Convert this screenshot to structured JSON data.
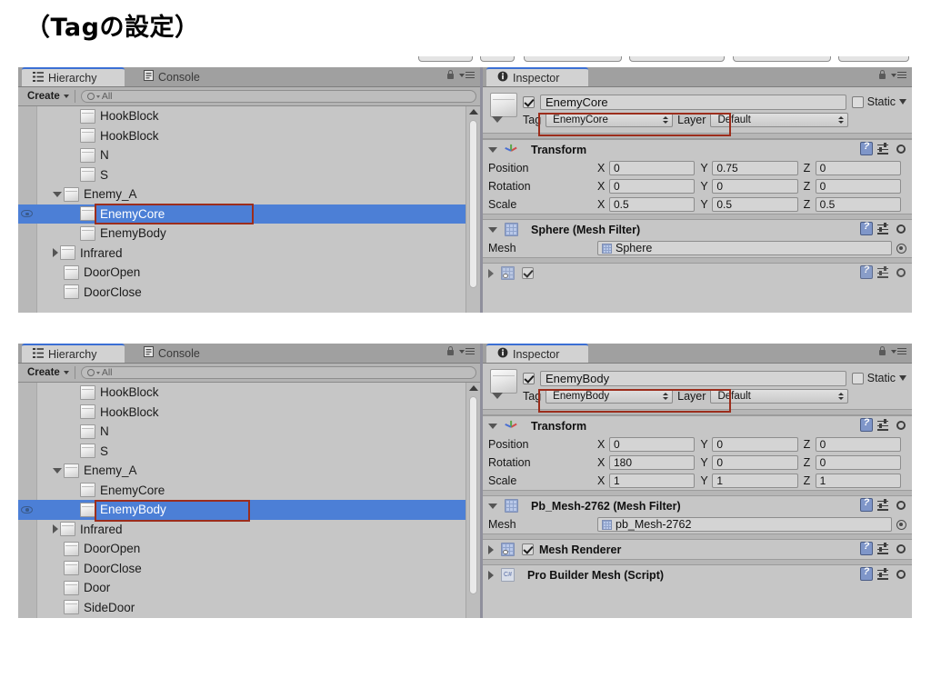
{
  "slide": {
    "title": "（Tagの設定）"
  },
  "shots": [
    {
      "hierarchy": {
        "tabs": [
          {
            "label": "Hierarchy",
            "icon": "hierarchy-list-icon",
            "active": true
          },
          {
            "label": "Console",
            "icon": "console-icon",
            "active": false
          }
        ],
        "toolbar": {
          "create_label": "Create",
          "search_placeholder": "All"
        },
        "tools": {
          "lock": "lock-icon",
          "menu": "panel-menu-icon"
        },
        "items": [
          {
            "label": "HookBlock",
            "depth": 2,
            "disclosure": "none",
            "selected": false,
            "visible_eye": false
          },
          {
            "label": "HookBlock",
            "depth": 2,
            "disclosure": "none",
            "selected": false,
            "visible_eye": false
          },
          {
            "label": "N",
            "depth": 2,
            "disclosure": "none",
            "selected": false,
            "visible_eye": false
          },
          {
            "label": "S",
            "depth": 2,
            "disclosure": "none",
            "selected": false,
            "visible_eye": false
          },
          {
            "label": "Enemy_A",
            "depth": 1,
            "disclosure": "open",
            "selected": false,
            "visible_eye": false
          },
          {
            "label": "EnemyCore",
            "depth": 2,
            "disclosure": "none",
            "selected": true,
            "visible_eye": true
          },
          {
            "label": "EnemyBody",
            "depth": 2,
            "disclosure": "none",
            "selected": false,
            "visible_eye": false
          },
          {
            "label": "Infrared",
            "depth": 1,
            "disclosure": "closed",
            "selected": false,
            "visible_eye": false
          },
          {
            "label": "DoorOpen",
            "depth": 1,
            "disclosure": "none",
            "selected": false,
            "visible_eye": false
          },
          {
            "label": "DoorClose",
            "depth": 1,
            "disclosure": "none",
            "selected": false,
            "visible_eye": false
          }
        ]
      },
      "inspector": {
        "tab": {
          "label": "Inspector",
          "icon": "info-icon"
        },
        "tools": {
          "lock": "lock-icon",
          "menu": "panel-menu-icon"
        },
        "object": {
          "enabled": true,
          "name": "EnemyCore",
          "static_label": "Static",
          "static_checked": false,
          "tag_label": "Tag",
          "tag_value": "EnemyCore",
          "layer_label": "Layer",
          "layer_value": "Default"
        },
        "transform": {
          "title": "Transform",
          "rows": [
            {
              "label": "Position",
              "x": "0",
              "y": "0.75",
              "z": "0"
            },
            {
              "label": "Rotation",
              "x": "0",
              "y": "0",
              "z": "0"
            },
            {
              "label": "Scale",
              "x": "0.5",
              "y": "0.5",
              "z": "0.5"
            }
          ],
          "axes": [
            "X",
            "Y",
            "Z"
          ]
        },
        "meshfilter": {
          "title": "Sphere (Mesh Filter)",
          "mesh_label": "Mesh",
          "mesh_value": "Sphere"
        }
      }
    },
    {
      "hierarchy": {
        "tabs": [
          {
            "label": "Hierarchy",
            "icon": "hierarchy-list-icon",
            "active": true
          },
          {
            "label": "Console",
            "icon": "console-icon",
            "active": false
          }
        ],
        "toolbar": {
          "create_label": "Create",
          "search_placeholder": "All"
        },
        "tools": {
          "lock": "lock-icon",
          "menu": "panel-menu-icon"
        },
        "items": [
          {
            "label": "HookBlock",
            "depth": 2,
            "disclosure": "none",
            "selected": false,
            "visible_eye": false
          },
          {
            "label": "HookBlock",
            "depth": 2,
            "disclosure": "none",
            "selected": false,
            "visible_eye": false
          },
          {
            "label": "N",
            "depth": 2,
            "disclosure": "none",
            "selected": false,
            "visible_eye": false
          },
          {
            "label": "S",
            "depth": 2,
            "disclosure": "none",
            "selected": false,
            "visible_eye": false
          },
          {
            "label": "Enemy_A",
            "depth": 1,
            "disclosure": "open",
            "selected": false,
            "visible_eye": false
          },
          {
            "label": "EnemyCore",
            "depth": 2,
            "disclosure": "none",
            "selected": false,
            "visible_eye": false
          },
          {
            "label": "EnemyBody",
            "depth": 2,
            "disclosure": "none",
            "selected": true,
            "visible_eye": true
          },
          {
            "label": "Infrared",
            "depth": 1,
            "disclosure": "closed",
            "selected": false,
            "visible_eye": false
          },
          {
            "label": "DoorOpen",
            "depth": 1,
            "disclosure": "none",
            "selected": false,
            "visible_eye": false
          },
          {
            "label": "DoorClose",
            "depth": 1,
            "disclosure": "none",
            "selected": false,
            "visible_eye": false
          },
          {
            "label": "Door",
            "depth": 1,
            "disclosure": "none",
            "selected": false,
            "visible_eye": false
          },
          {
            "label": "SideDoor",
            "depth": 1,
            "disclosure": "none",
            "selected": false,
            "visible_eye": false
          }
        ]
      },
      "inspector": {
        "tab": {
          "label": "Inspector",
          "icon": "info-icon"
        },
        "tools": {
          "lock": "lock-icon",
          "menu": "panel-menu-icon"
        },
        "object": {
          "enabled": true,
          "name": "EnemyBody",
          "static_label": "Static",
          "static_checked": false,
          "tag_label": "Tag",
          "tag_value": "EnemyBody",
          "layer_label": "Layer",
          "layer_value": "Default"
        },
        "transform": {
          "title": "Transform",
          "rows": [
            {
              "label": "Position",
              "x": "0",
              "y": "0",
              "z": "0"
            },
            {
              "label": "Rotation",
              "x": "180",
              "y": "0",
              "z": "0"
            },
            {
              "label": "Scale",
              "x": "1",
              "y": "1",
              "z": "1"
            }
          ],
          "axes": [
            "X",
            "Y",
            "Z"
          ]
        },
        "meshfilter": {
          "title": "Pb_Mesh-2762 (Mesh Filter)",
          "mesh_label": "Mesh",
          "mesh_value": "pb_Mesh-2762"
        },
        "meshrenderer": {
          "title": "Mesh Renderer",
          "enabled": true
        },
        "probuilder": {
          "title": "Pro Builder Mesh (Script)"
        }
      }
    }
  ],
  "colors": {
    "selection_blue": "#4c7fd6",
    "highlight_red": "#9c2d1c",
    "panel_bg": "#c6c6c6",
    "tab_active": "#d2d2d2",
    "tab_accent": "#3b6fd4"
  }
}
